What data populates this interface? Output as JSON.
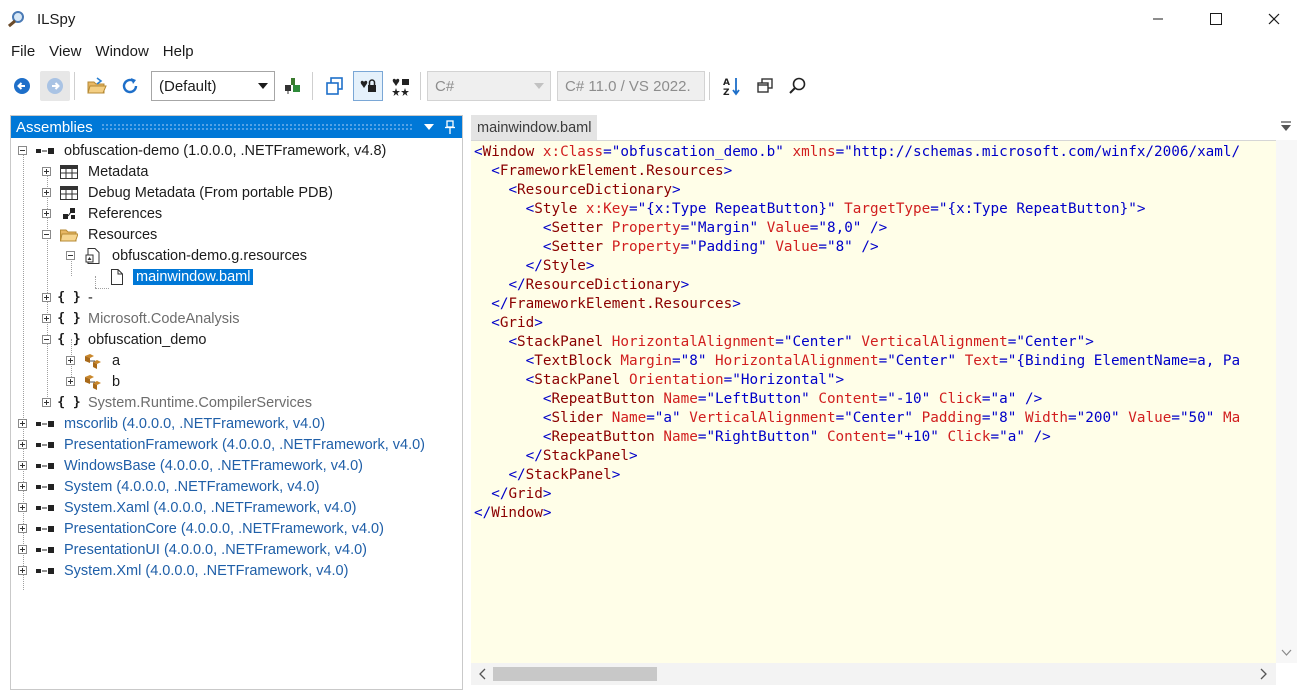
{
  "window": {
    "title": "ILSpy"
  },
  "menu": [
    "File",
    "View",
    "Window",
    "Help"
  ],
  "toolbar": {
    "language_combo": "(Default)",
    "lang_field": "C#",
    "version_field": "C# 11.0 / VS 2022."
  },
  "assemblies_panel": {
    "title": "Assemblies"
  },
  "tree": [
    {
      "label": "obfuscation-demo (1.0.0.0, .NETFramework, v4.8)",
      "style": "normal"
    },
    {
      "label": "Metadata",
      "style": "normal"
    },
    {
      "label": "Debug Metadata (From portable PDB)",
      "style": "normal"
    },
    {
      "label": "References",
      "style": "normal"
    },
    {
      "label": "Resources",
      "style": "normal"
    },
    {
      "label": "obfuscation-demo.g.resources",
      "style": "normal"
    },
    {
      "label": "mainwindow.baml",
      "style": "selected"
    },
    {
      "label": "-",
      "style": "normal"
    },
    {
      "label": "Microsoft.CodeAnalysis",
      "style": "gray"
    },
    {
      "label": "obfuscation_demo",
      "style": "normal"
    },
    {
      "label": "a",
      "style": "normal"
    },
    {
      "label": "b",
      "style": "normal"
    },
    {
      "label": "System.Runtime.CompilerServices",
      "style": "gray"
    },
    {
      "label": "mscorlib (4.0.0.0, .NETFramework, v4.0)",
      "style": "blue"
    },
    {
      "label": "PresentationFramework (4.0.0.0, .NETFramework, v4.0)",
      "style": "blue"
    },
    {
      "label": "WindowsBase (4.0.0.0, .NETFramework, v4.0)",
      "style": "blue"
    },
    {
      "label": "System (4.0.0.0, .NETFramework, v4.0)",
      "style": "blue"
    },
    {
      "label": "System.Xaml (4.0.0.0, .NETFramework, v4.0)",
      "style": "blue"
    },
    {
      "label": "PresentationCore (4.0.0.0, .NETFramework, v4.0)",
      "style": "blue"
    },
    {
      "label": "PresentationUI (4.0.0.0, .NETFramework, v4.0)",
      "style": "blue"
    },
    {
      "label": "System.Xml (4.0.0.0, .NETFramework, v4.0)",
      "style": "blue"
    }
  ],
  "editor": {
    "tab_title": "mainwindow.baml",
    "lines": [
      "<Window x:Class=\"obfuscation_demo.b\" xmlns=\"http://schemas.microsoft.com/winfx/2006/xaml/",
      "  <FrameworkElement.Resources>",
      "    <ResourceDictionary>",
      "      <Style x:Key=\"{x:Type RepeatButton}\" TargetType=\"{x:Type RepeatButton}\">",
      "        <Setter Property=\"Margin\" Value=\"8,0\" />",
      "        <Setter Property=\"Padding\" Value=\"8\" />",
      "      </Style>",
      "    </ResourceDictionary>",
      "  </FrameworkElement.Resources>",
      "  <Grid>",
      "    <StackPanel HorizontalAlignment=\"Center\" VerticalAlignment=\"Center\">",
      "      <TextBlock Margin=\"8\" HorizontalAlignment=\"Center\" Text=\"{Binding ElementName=a, Pa",
      "      <StackPanel Orientation=\"Horizontal\">",
      "        <RepeatButton Name=\"LeftButton\" Content=\"-10\" Click=\"a\" />",
      "        <Slider Name=\"a\" VerticalAlignment=\"Center\" Padding=\"8\" Width=\"200\" Value=\"50\" Ma",
      "        <RepeatButton Name=\"RightButton\" Content=\"+10\" Click=\"a\" />",
      "      </StackPanel>",
      "    </StackPanel>",
      "  </Grid>",
      "</Window>"
    ]
  },
  "colors": {
    "accent": "#0078d7",
    "editor_bg": "#fffee8",
    "xml_tag": "#8b0000",
    "xml_attr": "#d11f1f",
    "xml_value": "#0000c8",
    "reference_assembly": "#1f5fa8"
  }
}
